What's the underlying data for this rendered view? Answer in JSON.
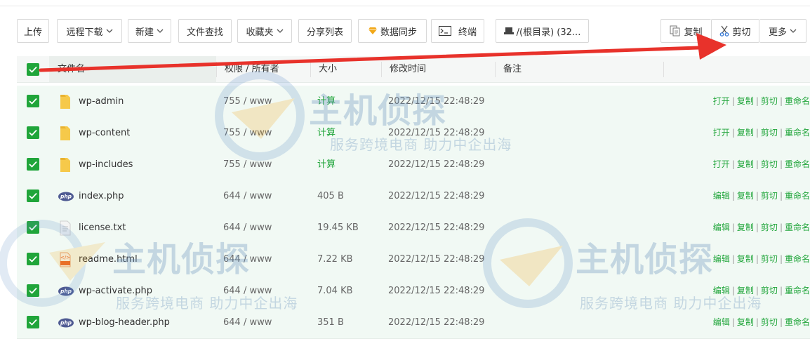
{
  "toolbar": {
    "upload": "上传",
    "remote_download": "远程下载",
    "new": "新建",
    "file_search": "文件查找",
    "favorites": "收藏夹",
    "share_list": "分享列表",
    "data_sync": "数据同步",
    "terminal": "终端",
    "path": "/(根目录) (32...",
    "copy": "复制",
    "cut": "剪切",
    "more": "更多"
  },
  "table": {
    "headers": {
      "name": "文件名",
      "perm": "权限 / 所有者",
      "size": "大小",
      "mtime": "修改时间",
      "note": "备注"
    },
    "rows": [
      {
        "name": "wp-admin",
        "type": "folder",
        "perm": "755 / www",
        "size": "计算",
        "mtime": "2022/12/15 22:48:29",
        "a1": "打开",
        "a2": "复制",
        "a3": "剪切",
        "a4": "重命名"
      },
      {
        "name": "wp-content",
        "type": "folder",
        "perm": "755 / www",
        "size": "计算",
        "mtime": "2022/12/15 22:48:29",
        "a1": "打开",
        "a2": "复制",
        "a3": "剪切",
        "a4": "重命名"
      },
      {
        "name": "wp-includes",
        "type": "folder",
        "perm": "755 / www",
        "size": "计算",
        "mtime": "2022/12/15 22:48:29",
        "a1": "打开",
        "a2": "复制",
        "a3": "剪切",
        "a4": "重命名"
      },
      {
        "name": "index.php",
        "type": "php",
        "perm": "644 / www",
        "size": "405 B",
        "mtime": "2022/12/15 22:48:29",
        "a1": "编辑",
        "a2": "复制",
        "a3": "剪切",
        "a4": "重命名"
      },
      {
        "name": "license.txt",
        "type": "txt",
        "perm": "644 / www",
        "size": "19.45 KB",
        "mtime": "2022/12/15 22:48:29",
        "a1": "编辑",
        "a2": "复制",
        "a3": "剪切",
        "a4": "重命名"
      },
      {
        "name": "readme.html",
        "type": "html",
        "perm": "644 / www",
        "size": "7.22 KB",
        "mtime": "2022/12/15 22:48:29",
        "a1": "编辑",
        "a2": "复制",
        "a3": "剪切",
        "a4": "重命名"
      },
      {
        "name": "wp-activate.php",
        "type": "php",
        "perm": "644 / www",
        "size": "7.04 KB",
        "mtime": "2022/12/15 22:48:29",
        "a1": "编辑",
        "a2": "复制",
        "a3": "剪切",
        "a4": "重命名"
      },
      {
        "name": "wp-blog-header.php",
        "type": "php",
        "perm": "644 / www",
        "size": "351 B",
        "mtime": "2022/12/15 22:48:29",
        "a1": "编辑",
        "a2": "复制",
        "a3": "剪切",
        "a4": "重命名"
      }
    ]
  },
  "watermark": {
    "brand": "主机侦探",
    "slogan": "服务跨境电商 助力中企出海"
  },
  "colors": {
    "accent": "#20a53a",
    "arrow": "#e8322b",
    "row_bg": "#f1f9f4"
  },
  "icons": {
    "folder": "folder-icon",
    "php": "php-file-icon",
    "txt": "text-file-icon",
    "html": "html-file-icon"
  }
}
